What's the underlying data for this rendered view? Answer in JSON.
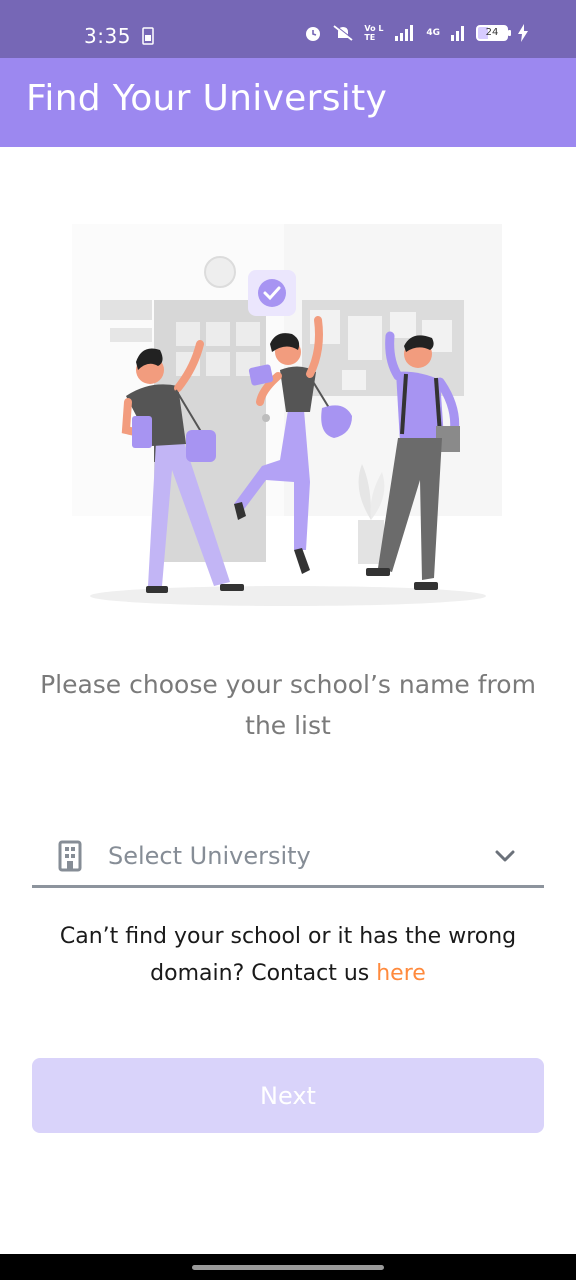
{
  "status_bar": {
    "time": "3:35",
    "battery": "24",
    "network": "4G",
    "volte": "Vo LTE"
  },
  "app_bar": {
    "title": "Find Your University"
  },
  "main": {
    "instruction": "Please choose your school’s name from the list",
    "university_select": {
      "placeholder": "Select University"
    },
    "help": {
      "text": "Can’t find your school or it has the wrong domain? Contact us ",
      "link": "here"
    },
    "next_button": "Next"
  },
  "colors": {
    "status_bar": "#7667b6",
    "app_bar": "#9c88f0",
    "accent_link": "#ff8a3d",
    "button_disabled": "#d9d3fa",
    "illustration_purple": "#a794f2"
  },
  "icons": {
    "select": "building-icon",
    "dropdown": "chevron-down-icon"
  }
}
